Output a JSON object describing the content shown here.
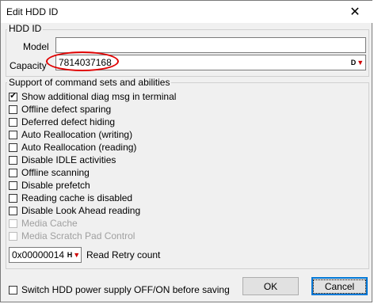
{
  "window": {
    "title": "Edit HDD ID",
    "close_glyph": "✕"
  },
  "hdd_id_group": {
    "legend": "HDD ID",
    "model_label": "Model",
    "model_value": "",
    "capacity_label": "Capacity",
    "capacity_value": "7814037168",
    "capacity_button": "D"
  },
  "support_group": {
    "legend": "Support of command sets and abilities",
    "options": [
      {
        "label": "Show additional diag msg in terminal",
        "checked": true,
        "enabled": true
      },
      {
        "label": "Offline defect sparing",
        "checked": false,
        "enabled": true
      },
      {
        "label": "Deferred defect hiding",
        "checked": false,
        "enabled": true
      },
      {
        "label": "Auto Reallocation (writing)",
        "checked": false,
        "enabled": true
      },
      {
        "label": "Auto Reallocation (reading)",
        "checked": false,
        "enabled": true
      },
      {
        "label": "Disable IDLE activities",
        "checked": false,
        "enabled": true
      },
      {
        "label": "Offline scanning",
        "checked": false,
        "enabled": true
      },
      {
        "label": "Disable prefetch",
        "checked": false,
        "enabled": true
      },
      {
        "label": "Reading cache is disabled",
        "checked": false,
        "enabled": true
      },
      {
        "label": "Disable Look Ahead reading",
        "checked": false,
        "enabled": true
      },
      {
        "label": "Media Cache",
        "checked": false,
        "enabled": false
      },
      {
        "label": "Media Scratch Pad Control",
        "checked": false,
        "enabled": false
      }
    ],
    "retry_value": "0x00000014",
    "retry_button": "H",
    "retry_label": "Read Retry count"
  },
  "footer": {
    "power_label": "Switch HDD power supply OFF/ON before saving",
    "power_checked": false,
    "ok_label": "OK",
    "cancel_label": "Cancel"
  },
  "colors": {
    "annotation_oval": "#e00000",
    "default_button_border": "#0078d7",
    "dialog_bg": "#f0f0f0"
  }
}
